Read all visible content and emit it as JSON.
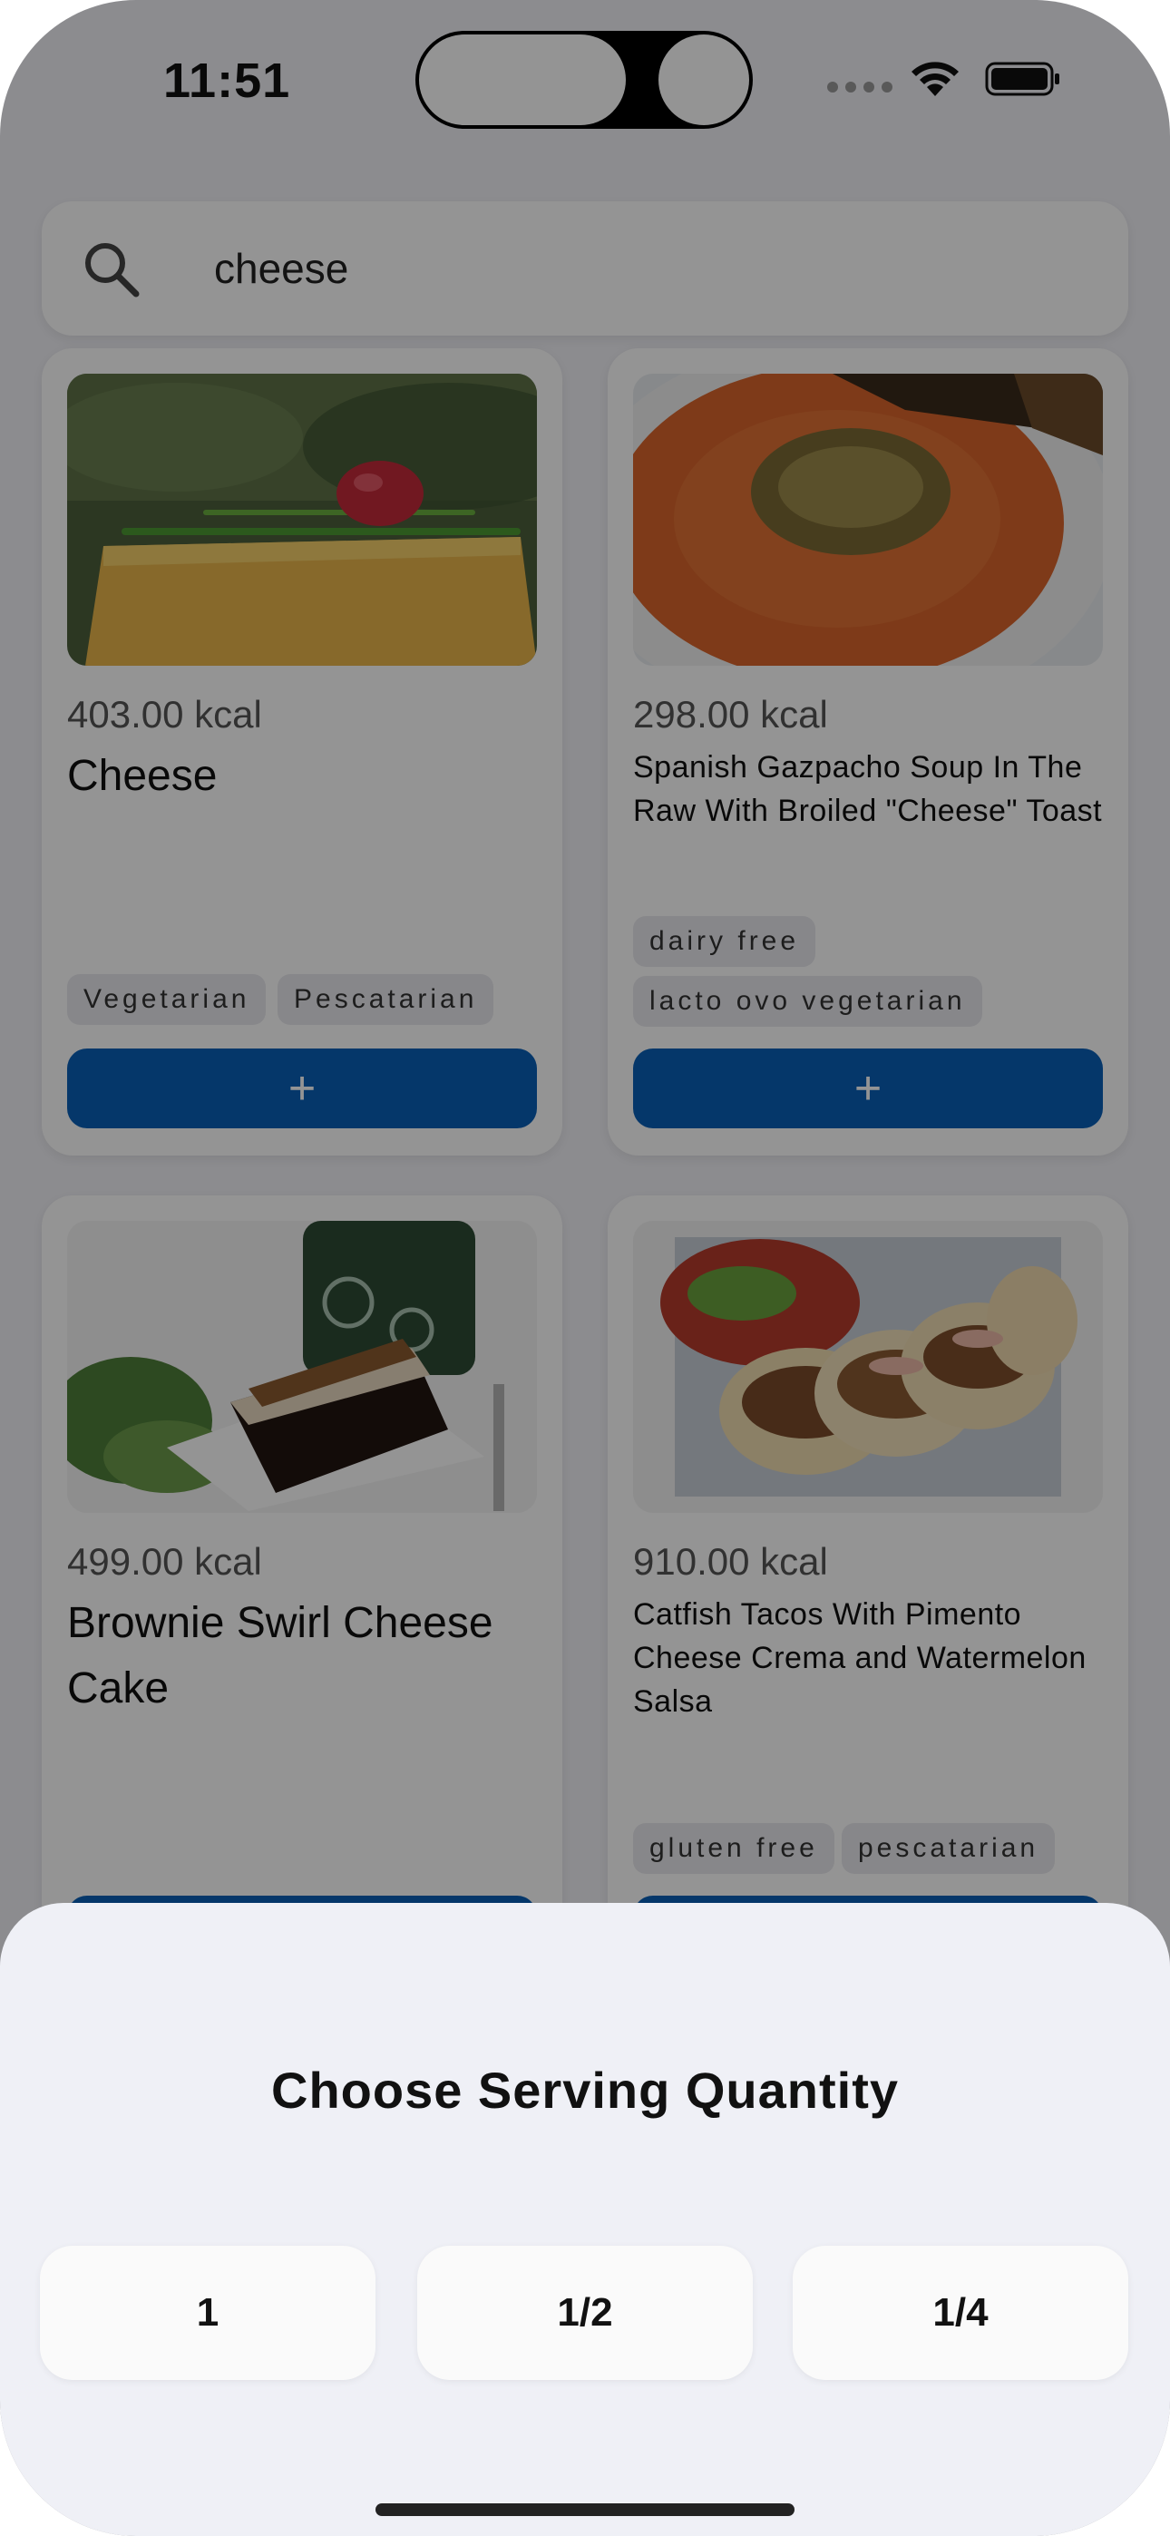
{
  "status_bar": {
    "time": "11:51"
  },
  "search": {
    "value": "cheese"
  },
  "cards": [
    {
      "kcal": "403.00 kcal",
      "title": "Cheese",
      "tags": [
        "Vegetarian",
        "Pescatarian"
      ],
      "add_label": "+"
    },
    {
      "kcal": "298.00 kcal",
      "title": "Spanish Gazpacho Soup In The Raw With Broiled \"Cheese\" Toast",
      "tags": [
        "dairy free",
        "lacto ovo vegetarian"
      ],
      "add_label": "+"
    },
    {
      "kcal": "499.00 kcal",
      "title": "Brownie Swirl Cheese Cake",
      "tags": [],
      "add_label": "+"
    },
    {
      "kcal": "910.00 kcal",
      "title": "Catfish Tacos With Pimento Cheese Crema and Watermelon Salsa",
      "tags": [
        "gluten free",
        "pescatarian"
      ],
      "add_label": "+"
    }
  ],
  "sheet": {
    "title": "Choose Serving Quantity",
    "options": [
      "1",
      "1/2",
      "1/4"
    ]
  },
  "colors": {
    "accent": "#0a5fb7",
    "sheet_bg": "#eff0f6"
  },
  "icons": [
    "search-icon",
    "wifi-icon",
    "battery-icon",
    "plus-icon"
  ]
}
